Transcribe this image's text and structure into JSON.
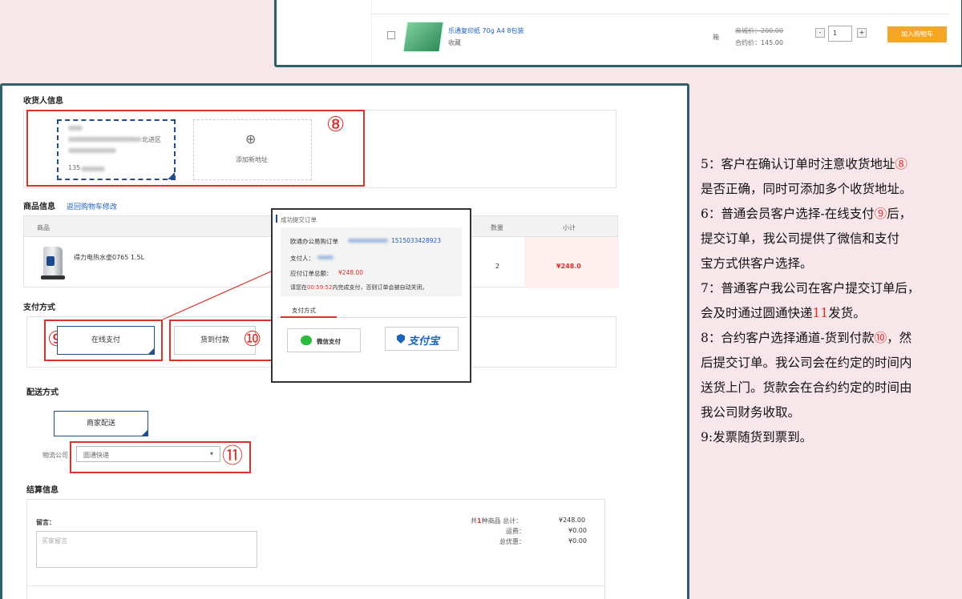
{
  "top_product": {
    "name": "乐通复印纸 70g A4 8包装",
    "collect": "收藏",
    "unit": "箱",
    "price_original": "商城价：200.00",
    "price_contract": "合约价：145.00",
    "quantity": "1",
    "minus": "-",
    "plus": "+",
    "add_to_cart": "加入购物车"
  },
  "receiver": {
    "section_title": "收货人信息",
    "address_fragment": "北进区",
    "phone_prefix": "135",
    "add_address": "添加新地址",
    "plus_symbol": "⊕"
  },
  "goods": {
    "section_title": "商品信息",
    "back_link": "返回购物车修改",
    "col_product": "商品",
    "col_qty": "数量",
    "col_subtotal": "小计",
    "item_name": "得力电热水壶0765 1.5L",
    "item_qty": "2",
    "item_subtotal": "¥248.0"
  },
  "payment": {
    "section_title": "支付方式",
    "online": "在线支付",
    "cod": "货到付款"
  },
  "delivery": {
    "section_title": "配送方式",
    "merchant": "商家配送",
    "logistics_label": "物流公司",
    "logistics_value": "圆通快递",
    "dropdown_arrow": "▾"
  },
  "settlement": {
    "section_title": "结算信息",
    "message_label": "留言：",
    "message_placeholder": "买家留言",
    "total_prefix": "共",
    "total_count": "1",
    "total_suffix": "种商品 总计：",
    "total_value": "¥248.00",
    "shipping_label": "运费：",
    "shipping_value": "¥0.00",
    "discount_label": "总优惠：",
    "discount_value": "¥0.00"
  },
  "popup": {
    "title": "成功提交订单",
    "order_label": "欧通办公易购订单",
    "order_no_tail": "1515033428923",
    "payer_label": "支付人：",
    "amount_label": "应付订单总额：",
    "amount_value": "¥248.00",
    "countdown_prefix": "请您在",
    "countdown_time": "00:59:52",
    "countdown_suffix": "内完成支付，否则订单会被自动关闭。",
    "tab_pay": "支付方式",
    "wechat": "微信支付",
    "alipay": "支付宝"
  },
  "markers": {
    "m8": "⑧",
    "m9": "⑨",
    "m10": "⑩",
    "m11": "⑪"
  },
  "notes": [
    {
      "pre": "5：客户在确认订单时注意收货地址",
      "num": "⑧",
      "post": ""
    },
    {
      "pre": "是否正确，同时可添加多个收货地址。",
      "num": "",
      "post": ""
    },
    {
      "pre": "6：普通会员客户选择-在线支付",
      "num": "⑨",
      "post": "后，"
    },
    {
      "pre": "提交订单，我公司提供了微信和支付",
      "num": "",
      "post": ""
    },
    {
      "pre": "宝方式供客户选择。",
      "num": "",
      "post": ""
    },
    {
      "pre": "7：普通客户我公司在客户提交订单后，",
      "num": "",
      "post": ""
    },
    {
      "pre": "会及时通过圆通快递",
      "num": "11",
      "post": "发货。"
    },
    {
      "pre": "8：合约客户选择通道-货到付款",
      "num": "⑩",
      "post": "，然"
    },
    {
      "pre": "后提交订单。我公司会在约定的时间内",
      "num": "",
      "post": ""
    },
    {
      "pre": "送货上门。货款会在合约约定的时间由",
      "num": "",
      "post": ""
    },
    {
      "pre": "我公司财务收取。",
      "num": "",
      "post": ""
    },
    {
      "pre": "9:发票随货到票到。",
      "num": "",
      "post": ""
    }
  ],
  "colors": {
    "accent_red": "#d9332b",
    "border_teal": "#2f5f6a",
    "select_blue": "#1e4e8c",
    "cart_orange": "#f5a623",
    "bg_pink": "#f7e6ea"
  }
}
